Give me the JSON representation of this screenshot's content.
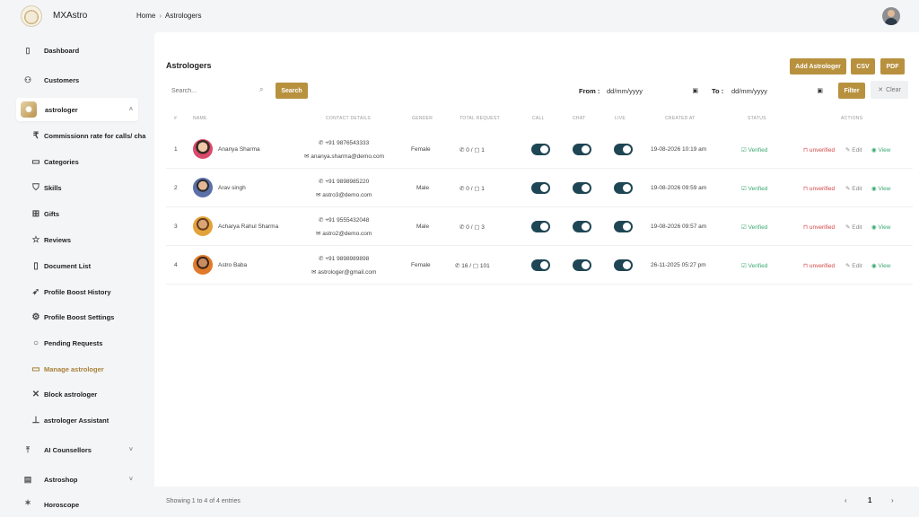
{
  "app": {
    "brand": "MXAstro"
  },
  "breadcrumb": {
    "home": "Home",
    "current": "Astrologers"
  },
  "sidebar": {
    "dashboard": "Dashboard",
    "customers": "Customers",
    "astrologer": "astrologer",
    "sub": [
      "Commissionn rate for calls/ cha",
      "Categories",
      "Skills",
      "Gifts",
      "Reviews",
      "Document List",
      "Profile Boost History",
      "Profile Boost Settings",
      "Pending Requests",
      "Manage astrologer",
      "Block astrologer",
      "astrologer Assistant"
    ],
    "ai_counsellors": "AI Counsellors",
    "astroshop": "Astroshop",
    "horoscope": "Horoscope"
  },
  "page": {
    "title": "Astrologers",
    "add_button": "Add Astrologer",
    "csv_button": "CSV",
    "pdf_button": "PDF",
    "search_placeholder": "Search...",
    "search_button": "Search",
    "from_label": "From :",
    "to_label": "To :",
    "date_placeholder": "dd/mm/yyyy",
    "filter_button": "Filter",
    "clear_button": "Clear"
  },
  "table": {
    "headers": [
      "#",
      "Name",
      "Contact Details",
      "Gender",
      "Total Request",
      "Call",
      "Chat",
      "Live",
      "Created At",
      "Status",
      "Actions"
    ],
    "rows": [
      {
        "index": "1",
        "name": "Ananya Sharma",
        "phone": "+91 9876543333",
        "email": "ananya.sharma@demo.com",
        "gender": "Female",
        "calls": "0",
        "chats": "1",
        "created": "19-08-2026 10:19 am",
        "status": "Verified",
        "call_on": true,
        "chat_on": true,
        "live_on": true
      },
      {
        "index": "2",
        "name": "Arav singh",
        "phone": "+91 9898985220",
        "email": "astro3@demo.com",
        "gender": "Male",
        "calls": "0",
        "chats": "1",
        "created": "19-08-2026 09:59 am",
        "status": "Verified",
        "call_on": true,
        "chat_on": true,
        "live_on": true
      },
      {
        "index": "3",
        "name": "Acharya Rahul Sharma",
        "phone": "+91 9555432048",
        "email": "astro2@demo.com",
        "gender": "Male",
        "calls": "0",
        "chats": "3",
        "created": "19-08-2026 09:57 am",
        "status": "Verified",
        "call_on": true,
        "chat_on": true,
        "live_on": true
      },
      {
        "index": "4",
        "name": "Astro Baba",
        "phone": "+91 9898989898",
        "email": "astrologer@gmail.com",
        "gender": "Female",
        "calls": "16",
        "chats": "101",
        "created": "26-11-2025 05:27 pm",
        "status": "Verified",
        "call_on": true,
        "chat_on": true,
        "live_on": true
      }
    ],
    "actions": {
      "unverified": "unverified",
      "edit": "Edit",
      "view": "View"
    }
  },
  "footer": {
    "summary": "Showing 1 to 4 of 4 entries",
    "page": "1"
  },
  "colors": {
    "accent": "#b8913f",
    "toggle": "#1f4654",
    "verified": "#3aa870",
    "unverified": "#d24545"
  }
}
